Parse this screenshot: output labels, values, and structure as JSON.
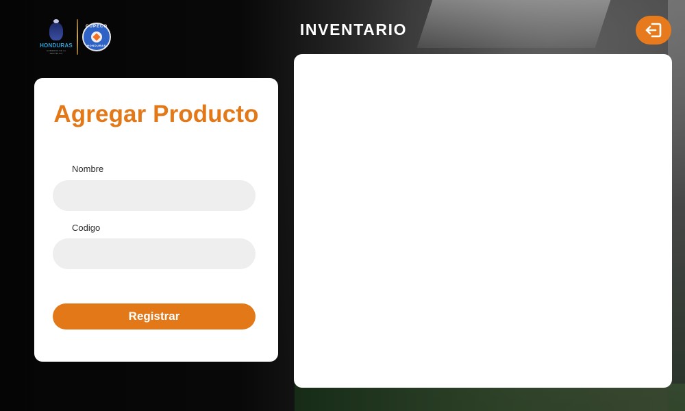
{
  "header": {
    "logo_honduras_text": "HONDURAS",
    "logo_honduras_subtitle": "GOBIERNO DE LA REPÚBLICA",
    "logo_copeco_top": "COPECO",
    "logo_copeco_bottom": "HONDURAS",
    "title": "INVENTARIO",
    "logout_icon": "logout-icon"
  },
  "form": {
    "title": "Agregar Producto",
    "fields": [
      {
        "label": "Nombre",
        "value": "",
        "placeholder": ""
      },
      {
        "label": "Codigo",
        "value": "",
        "placeholder": ""
      }
    ],
    "submit_label": "Registrar"
  },
  "colors": {
    "accent": "#e27818",
    "input_bg": "#eeeeee",
    "card_bg": "#ffffff"
  }
}
